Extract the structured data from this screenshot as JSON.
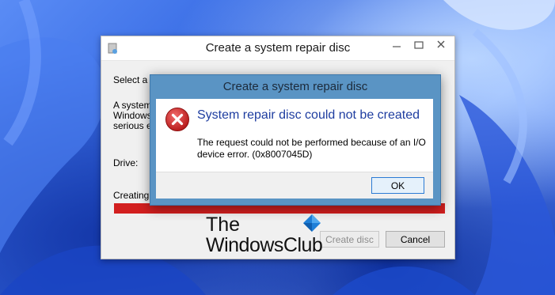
{
  "back_window": {
    "title": "Create a system repair disc",
    "select_label": "Select a C",
    "desc_line1": "A system",
    "desc_line2": "Windows",
    "desc_line3": "serious e",
    "drive_label": "Drive:",
    "creating_label": "Creating",
    "progress_value": 1.0,
    "progress_color": "#d21f1f",
    "create_button": "Create disc",
    "cancel_button": "Cancel"
  },
  "dialog": {
    "title": "Create a system repair disc",
    "main_instruction": "System repair disc could not be created",
    "message_line1": "The request could not be performed because of an I/O",
    "message_line2": "device error. (0x8007045D)",
    "ok_button": "OK",
    "icon": "error-icon",
    "title_bar_color": "#5a94c4",
    "instruction_color": "#1e3da0"
  },
  "watermark": {
    "line1": "The",
    "line2": "WindowsClub",
    "logo": "windows-logo-icon"
  }
}
